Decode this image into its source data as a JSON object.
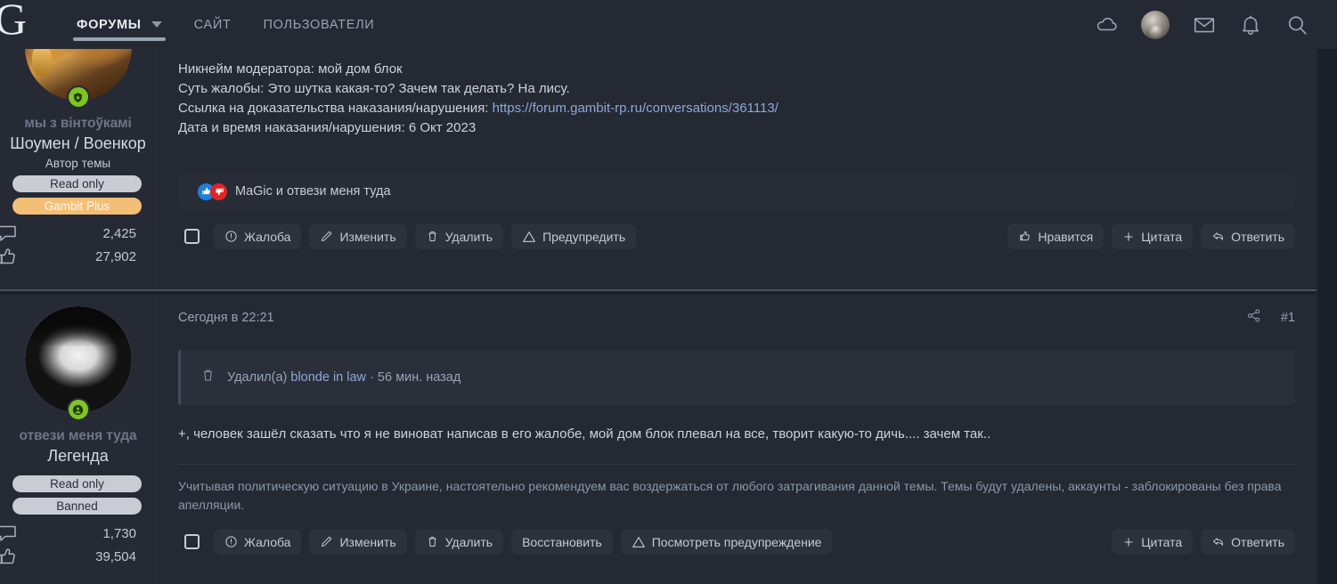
{
  "header": {
    "logo": "G",
    "nav": [
      {
        "label": "ФОРУМЫ",
        "active": true,
        "has_caret": true
      },
      {
        "label": "САЙТ",
        "active": false,
        "has_caret": false
      },
      {
        "label": "ПОЛЬЗОВАТЕЛИ",
        "active": false,
        "has_caret": false
      }
    ],
    "icons": [
      "cloud-icon",
      "user-avatar",
      "mail-icon",
      "bell-icon",
      "search-icon"
    ],
    "background": "#242933"
  },
  "posts": [
    {
      "sidebar": {
        "tagline": "мы з вінтоўкамі",
        "username": "Шоумен / Военкор",
        "role": "Автор темы",
        "badges": [
          {
            "label": "Read only",
            "style": "gray"
          },
          {
            "label": "Gambit Plus",
            "style": "orange"
          }
        ],
        "stats": [
          {
            "icon": "message-icon",
            "value": "2,425"
          },
          {
            "icon": "thumbs-up-icon",
            "value": "27,902"
          }
        ],
        "online": true
      },
      "content_lines": [
        {
          "text": "Никнейм модератора: мой дом блок",
          "link": null
        },
        {
          "text": "Суть жалобы: Это шутка какая-то? Зачем так делать? На лису.",
          "link": null
        },
        {
          "text": "Ссылка на доказательства наказания/нарушения: ",
          "link": "https://forum.gambit-rp.ru/conversations/361113/"
        },
        {
          "text": "Дата и время наказания/нарушения: 6 Окт 2023",
          "link": null
        }
      ],
      "reactions": {
        "icons": [
          "thumbs-up-reaction",
          "thumbs-down-reaction"
        ],
        "text": "MaGic и отвези меня туда"
      },
      "actions_left": [
        {
          "label": "",
          "icon": "checkbox",
          "type": "checkbox"
        },
        {
          "label": "Жалоба",
          "icon": "report-icon"
        },
        {
          "label": "Изменить",
          "icon": "pencil-icon"
        },
        {
          "label": "Удалить",
          "icon": "trash-icon"
        },
        {
          "label": "Предупредить",
          "icon": "warning-icon"
        }
      ],
      "actions_right": [
        {
          "label": "Нравится",
          "icon": "thumbs-up-icon"
        },
        {
          "label": "Цитата",
          "icon": "plus-icon"
        },
        {
          "label": "Ответить",
          "icon": "reply-icon"
        }
      ]
    },
    {
      "sidebar": {
        "tagline": "отвези меня туда",
        "username": "Легенда",
        "role": null,
        "badges": [
          {
            "label": "Read only",
            "style": "gray"
          },
          {
            "label": "Banned",
            "style": "gray"
          }
        ],
        "stats": [
          {
            "icon": "message-icon",
            "value": "1,730"
          },
          {
            "icon": "thumbs-up-icon",
            "value": "39,504"
          }
        ],
        "online": true
      },
      "meta": {
        "date": "Сегодня в 22:21",
        "share_icon": "share-icon",
        "post_number": "#1"
      },
      "deleted_notice": {
        "icon": "trash-icon",
        "prefix": "Удалил(а) ",
        "user": "blonde in law",
        "separator": " · ",
        "time": "56 мин. назад"
      },
      "message": "+, человек зашёл сказать что я не виноват написав в его жалобе, мой дом блок плевал на все, творит какую-то дичь.... зачем так..",
      "signature": "Учитывая политическую ситуацию в Украине, настоятельно рекомендуем вас воздержаться от любого затрагивания данной темы. Темы будут удалены, аккаунты - заблокированы без права апелляции.",
      "actions_left": [
        {
          "label": "",
          "icon": "checkbox",
          "type": "checkbox"
        },
        {
          "label": "Жалоба",
          "icon": "report-icon"
        },
        {
          "label": "Изменить",
          "icon": "pencil-icon"
        },
        {
          "label": "Удалить",
          "icon": "trash-icon"
        },
        {
          "label": "Восстановить",
          "icon": null
        },
        {
          "label": "Посмотреть предупреждение",
          "icon": "warning-icon"
        }
      ],
      "actions_right": [
        {
          "label": "Цитата",
          "icon": "plus-icon"
        },
        {
          "label": "Ответить",
          "icon": "reply-icon"
        }
      ]
    }
  ],
  "colors": {
    "page_bg": "#1b1f27",
    "header_bg": "#242933",
    "post_bg": "#242933",
    "sidebar_bg": "#252a34",
    "accent_link": "#8ea8d8",
    "badge_orange": "#f3bf77",
    "badge_gray": "#c9ccd3",
    "online_green": "#7ec422"
  }
}
